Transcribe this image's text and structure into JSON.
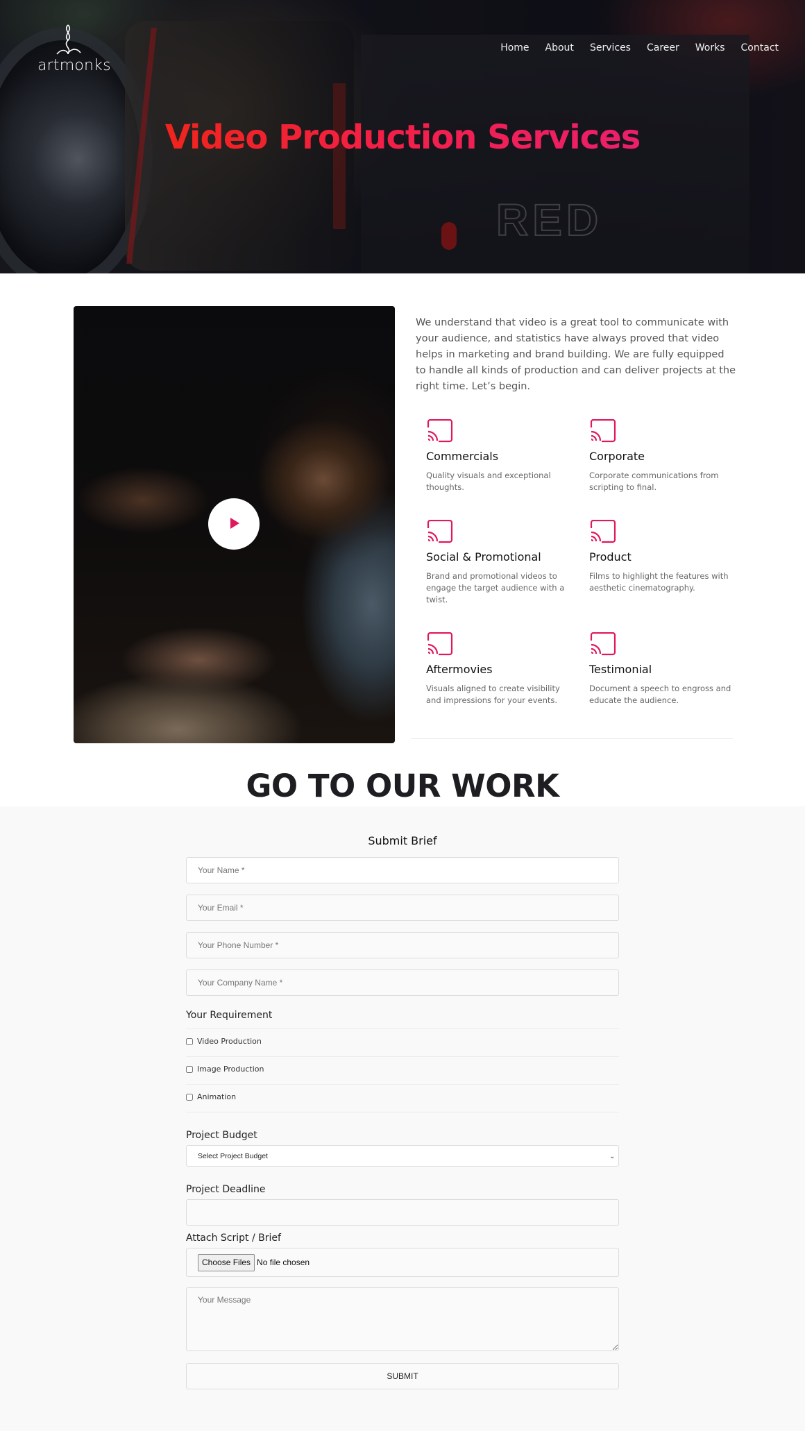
{
  "brand": {
    "name": "artmonks",
    "accent_color": "#e0195a",
    "title_gradient": [
      "#f0241c",
      "#ec1f6c"
    ]
  },
  "nav": {
    "items": [
      {
        "label": "Home"
      },
      {
        "label": "About"
      },
      {
        "label": "Services"
      },
      {
        "label": "Career"
      },
      {
        "label": "Works"
      },
      {
        "label": "Contact"
      }
    ]
  },
  "hero": {
    "title": "Video Production Services",
    "background_image": "cinema camera lens (RED Raven)"
  },
  "video": {
    "play_icon": "play-icon",
    "image": "man writing at desk"
  },
  "intro": {
    "text": "We understand that video is a great tool to communicate with your audience, and statistics have always proved that video helps in marketing and brand building. We are fully equipped to handle all kinds of production and can deliver projects at the right time. Let’s begin."
  },
  "services": [
    {
      "icon": "cast-icon",
      "title": "Commercials",
      "description": "Quality visuals and exceptional thoughts."
    },
    {
      "icon": "cast-icon",
      "title": "Corporate",
      "description": "Corporate communications from scripting to final."
    },
    {
      "icon": "cast-icon",
      "title": "Social & Promotional",
      "description": "Brand and promotional videos to engage the target audience with a twist."
    },
    {
      "icon": "cast-icon",
      "title": "Product",
      "description": "Films to highlight the features with aesthetic cinematography."
    },
    {
      "icon": "cast-icon",
      "title": "Aftermovies",
      "description": "Visuals aligned to create visibility and impressions for your events."
    },
    {
      "icon": "cast-icon",
      "title": "Testimonial",
      "description": "Document a speech to engross and educate the audience."
    }
  ],
  "work": {
    "title": "GO TO OUR WORK"
  },
  "form": {
    "title": "Submit Brief",
    "name": {
      "placeholder": "Your Name *",
      "value": ""
    },
    "email": {
      "placeholder": "Your Email *",
      "value": ""
    },
    "phone": {
      "placeholder": "Your Phone Number *",
      "value": ""
    },
    "company": {
      "placeholder": "Your Company Name *",
      "value": ""
    },
    "requirement_label": "Your Requirement",
    "requirements": [
      {
        "label": "Video Production",
        "checked": false
      },
      {
        "label": "Image Production",
        "checked": false
      },
      {
        "label": "Animation",
        "checked": false
      }
    ],
    "budget_label": "Project Budget",
    "budget_selected": "Select Project Budget",
    "deadline_label": "Project Deadline",
    "deadline_value": "",
    "attach_label": "Attach Script / Brief",
    "file_button": "Choose Files",
    "file_status": "No file chosen",
    "message": {
      "placeholder": "Your Message",
      "value": ""
    },
    "submit_label": "SUBMIT"
  }
}
